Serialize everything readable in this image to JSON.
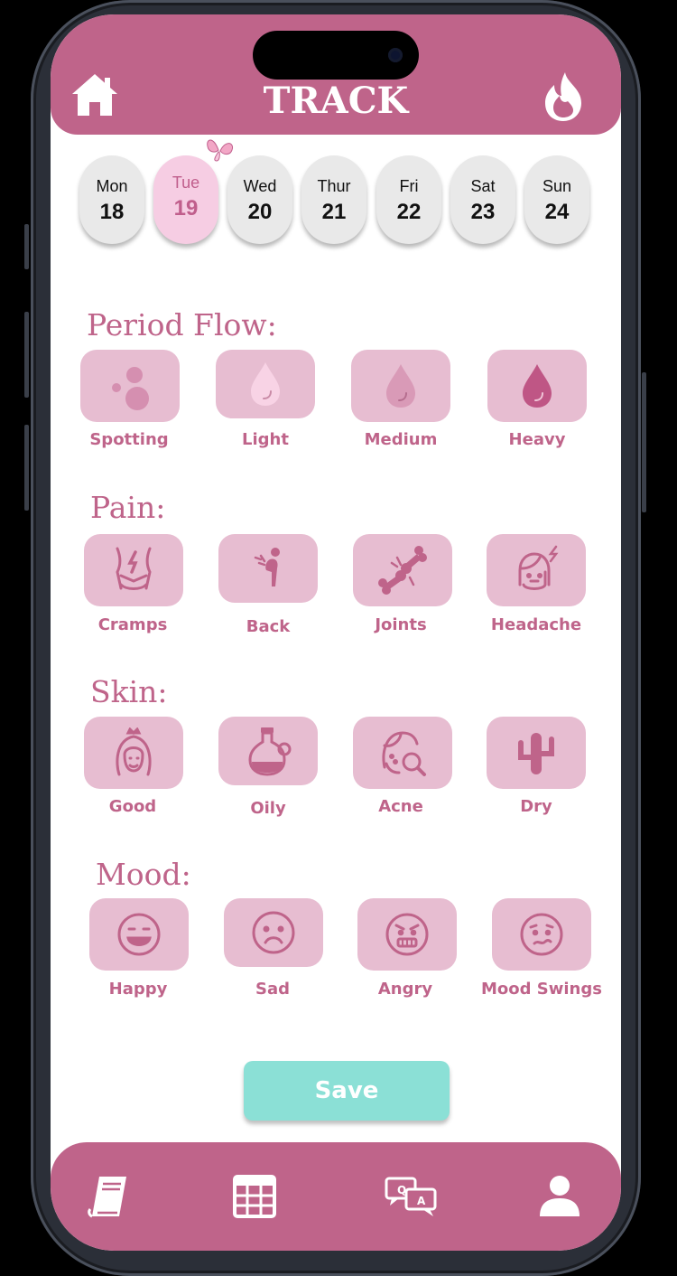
{
  "header": {
    "title": "TRACK"
  },
  "days": [
    {
      "name": "Mon",
      "date": "18"
    },
    {
      "name": "Tue",
      "date": "19",
      "selected": true
    },
    {
      "name": "Wed",
      "date": "20"
    },
    {
      "name": "Thur",
      "date": "21"
    },
    {
      "name": "Fri",
      "date": "22"
    },
    {
      "name": "Sat",
      "date": "23"
    },
    {
      "name": "Sun",
      "date": "24"
    }
  ],
  "sections": {
    "flow": {
      "title": "Period Flow:",
      "options": [
        "Spotting",
        "Light",
        "Medium",
        "Heavy"
      ]
    },
    "pain": {
      "title": "Pain:",
      "options": [
        "Cramps",
        "Back",
        "Joints",
        "Headache"
      ]
    },
    "skin": {
      "title": "Skin:",
      "options": [
        "Good",
        "Oily",
        "Acne",
        "Dry"
      ]
    },
    "mood": {
      "title": "Mood:",
      "options": [
        "Happy",
        "Sad",
        "Angry",
        "Mood Swings"
      ]
    }
  },
  "save_label": "Save",
  "colors": {
    "primary": "#bf648a",
    "tile": "#e7bdd1",
    "save": "#8be0d6",
    "selected_day": "#f6cde3"
  },
  "icons": {
    "nav": [
      "book-icon",
      "calendar-grid-icon",
      "qa-chat-icon",
      "profile-icon"
    ]
  }
}
